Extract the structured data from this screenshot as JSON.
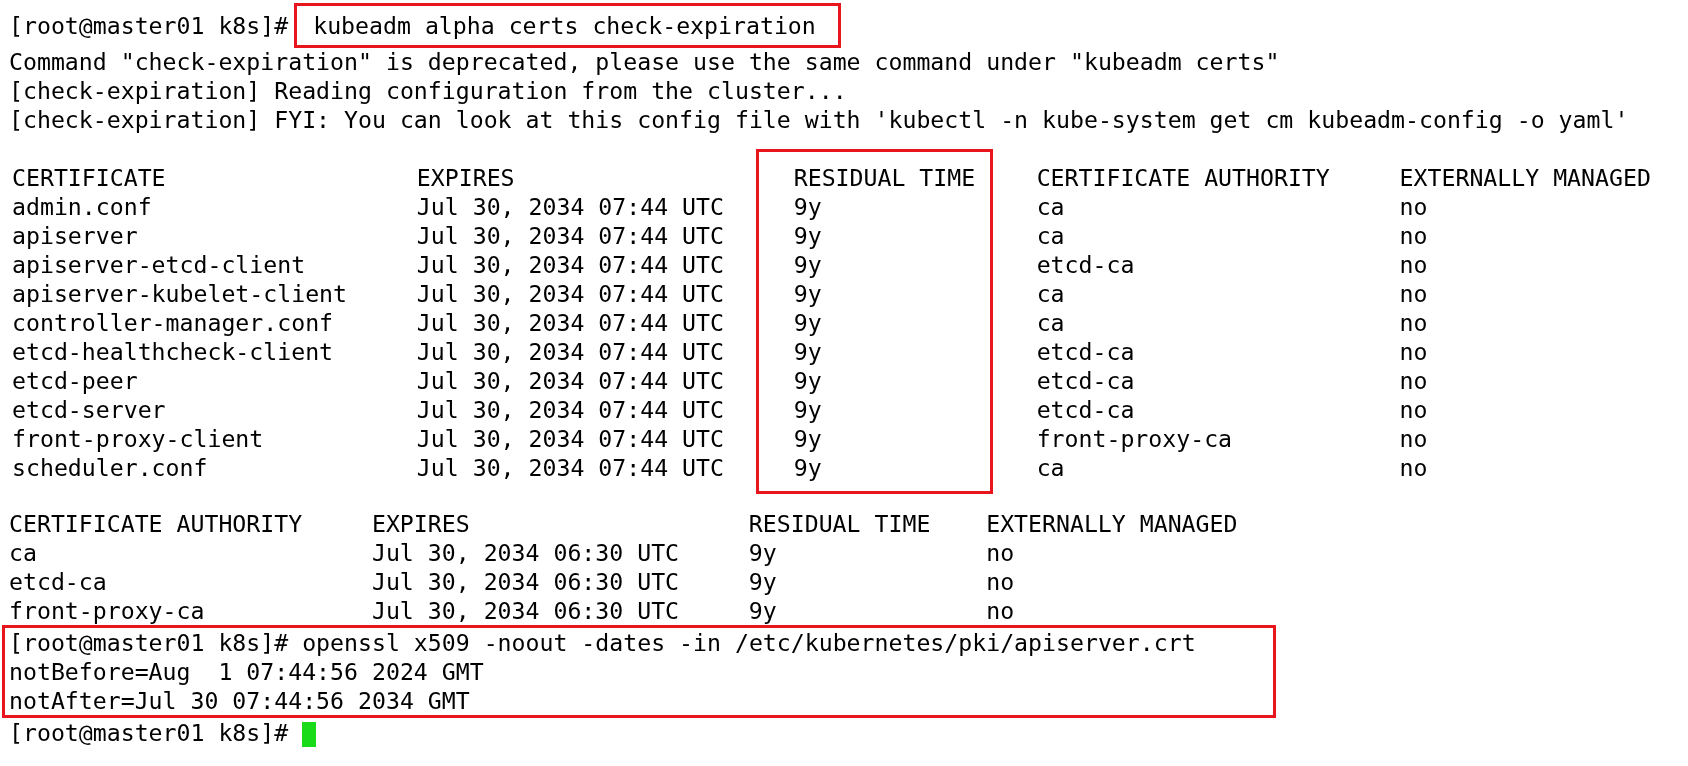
{
  "terminal": {
    "lines_before": [
      {
        "kind": "command",
        "prompt": "[root@master01 k8s]#",
        "command": "kubeadm alpha certs check-expiration",
        "highlighted": true
      },
      {
        "kind": "output",
        "text": "Command \"check-expiration\" is deprecated, please use the same command under \"kubeadm certs\""
      },
      {
        "kind": "output",
        "text": "[check-expiration] Reading configuration from the cluster..."
      },
      {
        "kind": "output",
        "text": "[check-expiration] FYI: You can look at this config file with 'kubectl -n kube-system get cm kubeadm-config -o yaml'"
      }
    ],
    "certificates_table": {
      "columns": [
        {
          "header": "CERTIFICATE",
          "highlighted": false
        },
        {
          "header": "EXPIRES",
          "highlighted": false
        },
        {
          "header": "RESIDUAL TIME",
          "highlighted": true
        },
        {
          "header": "CERTIFICATE AUTHORITY",
          "highlighted": false
        },
        {
          "header": "EXTERNALLY MANAGED",
          "highlighted": false
        }
      ],
      "rows": [
        [
          "admin.conf",
          "Jul 30, 2034 07:44 UTC",
          "9y",
          "ca",
          "no"
        ],
        [
          "apiserver",
          "Jul 30, 2034 07:44 UTC",
          "9y",
          "ca",
          "no"
        ],
        [
          "apiserver-etcd-client",
          "Jul 30, 2034 07:44 UTC",
          "9y",
          "etcd-ca",
          "no"
        ],
        [
          "apiserver-kubelet-client",
          "Jul 30, 2034 07:44 UTC",
          "9y",
          "ca",
          "no"
        ],
        [
          "controller-manager.conf",
          "Jul 30, 2034 07:44 UTC",
          "9y",
          "ca",
          "no"
        ],
        [
          "etcd-healthcheck-client",
          "Jul 30, 2034 07:44 UTC",
          "9y",
          "etcd-ca",
          "no"
        ],
        [
          "etcd-peer",
          "Jul 30, 2034 07:44 UTC",
          "9y",
          "etcd-ca",
          "no"
        ],
        [
          "etcd-server",
          "Jul 30, 2034 07:44 UTC",
          "9y",
          "etcd-ca",
          "no"
        ],
        [
          "front-proxy-client",
          "Jul 30, 2034 07:44 UTC",
          "9y",
          "front-proxy-ca",
          "no"
        ],
        [
          "scheduler.conf",
          "Jul 30, 2034 07:44 UTC",
          "9y",
          "ca",
          "no"
        ]
      ]
    },
    "authorities_table": {
      "columns": [
        {
          "header": "CERTIFICATE AUTHORITY",
          "highlighted": false
        },
        {
          "header": "EXPIRES",
          "highlighted": false
        },
        {
          "header": "RESIDUAL TIME",
          "highlighted": false
        },
        {
          "header": "EXTERNALLY MANAGED",
          "highlighted": false
        }
      ],
      "rows": [
        [
          "ca",
          "Jul 30, 2034 06:30 UTC",
          "9y",
          "no"
        ],
        [
          "etcd-ca",
          "Jul 30, 2034 06:30 UTC",
          "9y",
          "no"
        ],
        [
          "front-proxy-ca",
          "Jul 30, 2034 06:30 UTC",
          "9y",
          "no"
        ]
      ]
    },
    "final_block": {
      "highlighted": true,
      "lines": [
        {
          "kind": "command",
          "prompt": "[root@master01 k8s]#",
          "command": "openssl x509 -noout -dates -in /etc/kubernetes/pki/apiserver.crt"
        },
        {
          "kind": "output",
          "text": "notBefore=Aug  1 07:44:56 2024 GMT"
        },
        {
          "kind": "output",
          "text": "notAfter=Jul 30 07:44:56 2034 GMT"
        }
      ]
    },
    "prompt": {
      "text": "[root@master01 k8s]#",
      "cursor": true
    }
  }
}
